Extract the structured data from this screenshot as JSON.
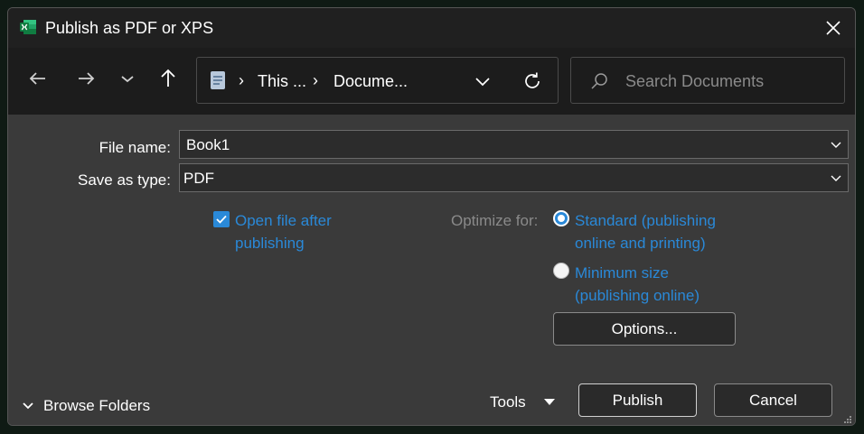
{
  "titlebar": {
    "title": "Publish as PDF or XPS"
  },
  "path": {
    "segment1": "This ...",
    "segment2": "Docume..."
  },
  "search": {
    "placeholder": "Search Documents"
  },
  "form": {
    "file_name_label": "File name:",
    "file_name_value": "Book1",
    "save_as_type_label": "Save as type:",
    "save_as_type_value": "PDF"
  },
  "options": {
    "open_after_line1": "Open file after",
    "open_after_line2": "publishing",
    "open_after_checked": true,
    "optimize_label": "Optimize for:",
    "standard_line1": "Standard (publishing",
    "standard_line2": "online and printing)",
    "standard_selected": true,
    "minimum_line1": "Minimum size",
    "minimum_line2": "(publishing online)",
    "options_button": "Options..."
  },
  "footer": {
    "browse_folders": "Browse Folders",
    "tools": "Tools",
    "publish": "Publish",
    "cancel": "Cancel"
  },
  "colors": {
    "accent": "#2a89d8",
    "excel_green": "#107c41"
  }
}
